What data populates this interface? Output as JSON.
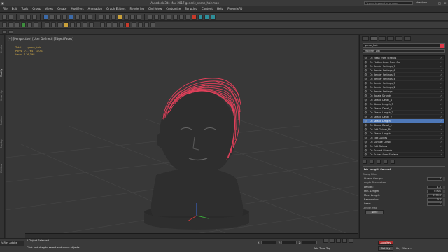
{
  "window": {
    "title": "Autodesk 3ds Max 2017  generic_scene_hair.max",
    "search_placeholder": "Type a keyword or phrase",
    "user": "chaelyoo"
  },
  "menu": [
    "File",
    "Edit",
    "Tools",
    "Group",
    "Views",
    "Create",
    "Modifiers",
    "Animation",
    "Graph Editors",
    "Rendering",
    "Civil View",
    "Customize",
    "Scripting",
    "Content",
    "Help",
    "PhoenixFD"
  ],
  "viewport": {
    "label": "[+] [Perspective] [User Defined] [Edged Faces]",
    "stats": {
      "total_label": "Total",
      "object_label": "game_hair",
      "polys_label": "Polys:",
      "polys_total": "77,764",
      "polys_obj": "1,063",
      "verts_label": "Verts:",
      "verts_total": "116,398"
    }
  },
  "left_tabs": [
    "Create",
    "Modify",
    "Hierarchy",
    "Motion",
    "Display",
    "Utilities"
  ],
  "right_panel": {
    "object_name": "game_hair",
    "modifier_list": "Modifier List",
    "stack": [
      {
        "label": "Ox Mesh From Strands",
        "selected": false
      },
      {
        "label": "Ox Flatten Array From Cur",
        "selected": false
      },
      {
        "label": "Ox Render Settings_7",
        "selected": false
      },
      {
        "label": "Ox Render Settings_6",
        "selected": false
      },
      {
        "label": "Ox Render Settings_5",
        "selected": false
      },
      {
        "label": "Ox Render Settings_4",
        "selected": false
      },
      {
        "label": "Ox Render Settings_3",
        "selected": false
      },
      {
        "label": "Ox Render Settings_2",
        "selected": false
      },
      {
        "label": "Ox Render Settings",
        "selected": false
      },
      {
        "label": "Ox Rotate Strands",
        "selected": false
      },
      {
        "label": "Ox Strand Detail_4",
        "selected": false
      },
      {
        "label": "Ox Strand Length_3",
        "selected": false
      },
      {
        "label": "Ox Strand Detail_3",
        "selected": false
      },
      {
        "label": "Ox Strand Length_2",
        "selected": false
      },
      {
        "label": "Ox Strand Detail_2",
        "selected": false
      },
      {
        "label": "Ox Strand Length",
        "selected": true
      },
      {
        "label": "Ox Strand Detail_1",
        "selected": false
      },
      {
        "label": "Ox Edit Guides_Ba",
        "selected": false
      },
      {
        "label": "Ox Strand Length",
        "selected": false
      },
      {
        "label": "Ox Edit Guides",
        "selected": false
      },
      {
        "label": "Ox Surface Comb",
        "selected": false
      },
      {
        "label": "Ox Edit Guides",
        "selected": false
      },
      {
        "label": "Ox Ground Strands",
        "selected": false
      },
      {
        "label": "Ox Guides from Surface",
        "selected": false
      },
      {
        "label": "Editable Poly",
        "selected": false
      }
    ],
    "rollout": {
      "title": "Hair Length Control",
      "group_filter": "Group Filter",
      "strand_groups_label": "Strand Groups:",
      "strand_groups_value": "0",
      "length_params": "Length Parameters",
      "params": [
        {
          "label": "Length:",
          "value": "1.0"
        },
        {
          "label": "Min. Length:",
          "value": "0.001"
        },
        {
          "label": "Max. Length:",
          "value": "9999.0"
        },
        {
          "label": "Randomize:",
          "value": "0.0"
        },
        {
          "label": "Seed:",
          "value": "1"
        }
      ],
      "length_map": "Length Map",
      "none_label": "None"
    }
  },
  "status": {
    "vray": "V-Ray Adobe",
    "selected": "1 Object Selected",
    "hint": "Click and drag to select and move objects",
    "x_label": "X:",
    "y_label": "Y:",
    "z_label": "Z:",
    "add_time_tag": "Add Time Tag",
    "auto_key": "Auto Key",
    "set_key": "Set Key",
    "key_filters": "Key Filters..."
  },
  "colors": {
    "hair": "#e0405a",
    "selection": "#4e78b8",
    "stats": "#d8b04a"
  }
}
